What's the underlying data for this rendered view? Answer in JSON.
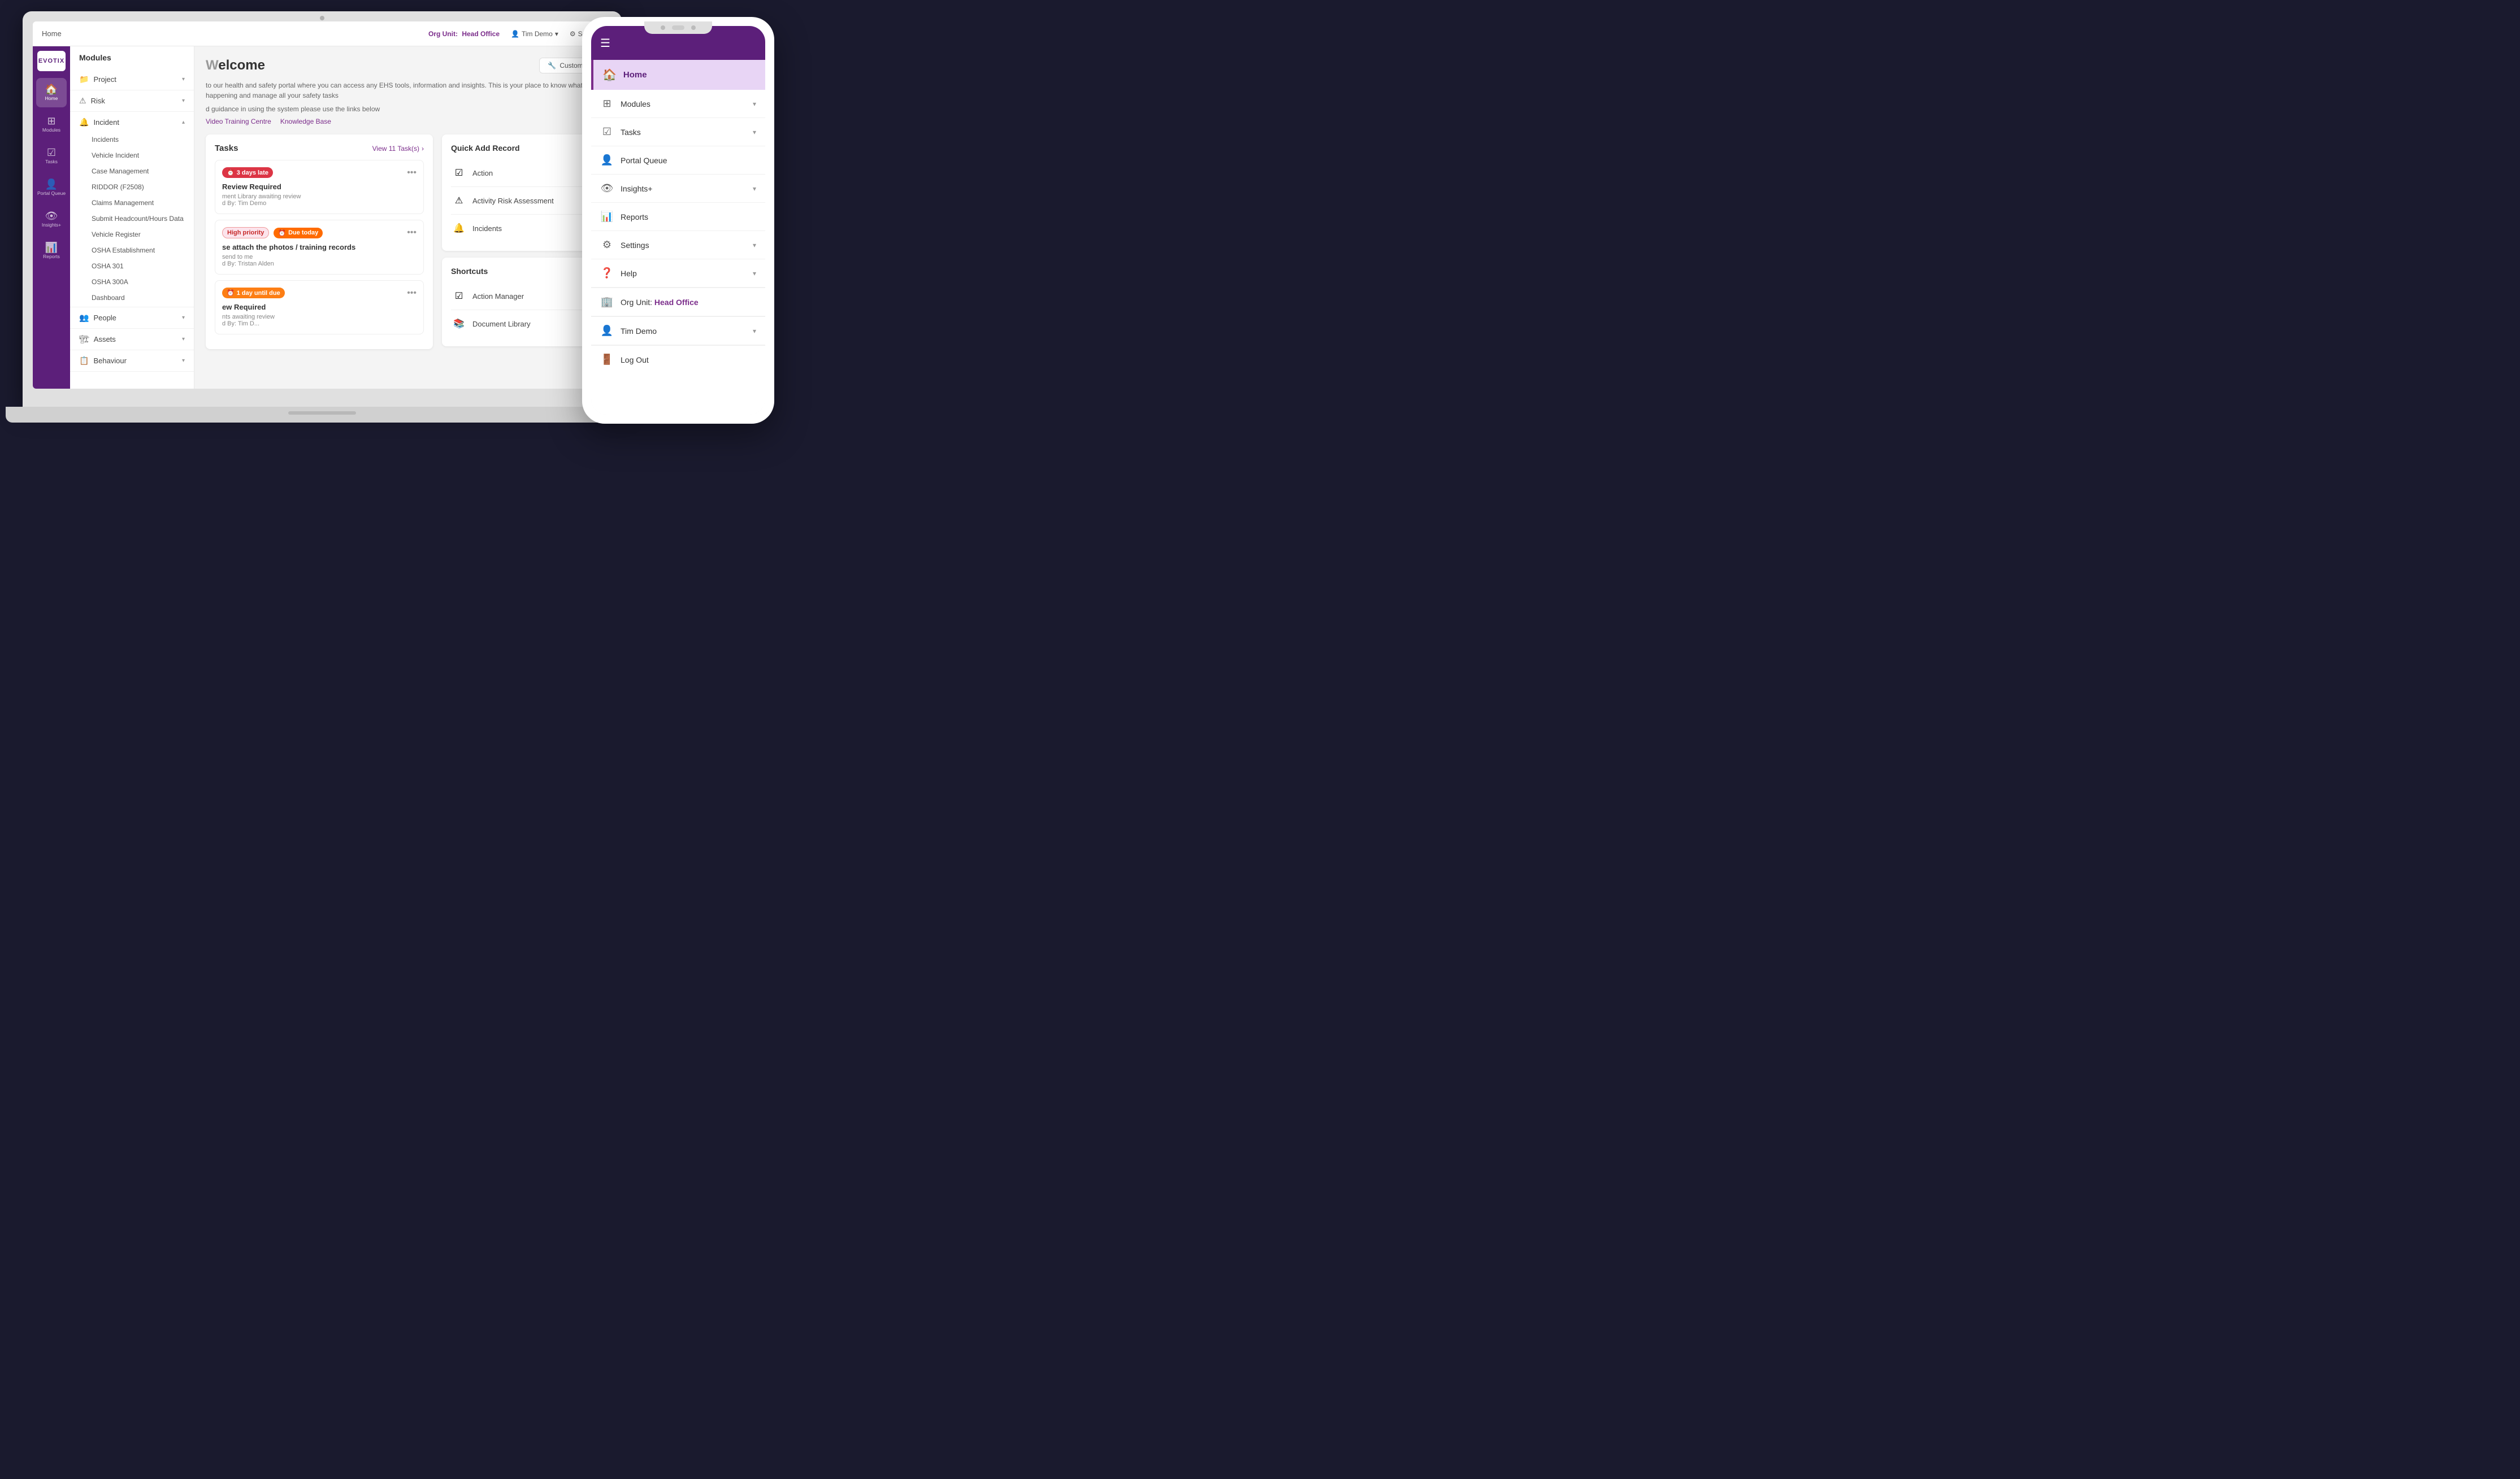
{
  "app": {
    "logo": "EVOTIX"
  },
  "topbar": {
    "breadcrumb": "Home",
    "org_unit_label": "Org Unit:",
    "org_unit_value": "Head Office",
    "user": "Tim Demo",
    "settings": "Settings"
  },
  "sidebar": {
    "items": [
      {
        "id": "home",
        "icon": "🏠",
        "label": "Home",
        "active": true
      },
      {
        "id": "modules",
        "icon": "⊞",
        "label": "Modules",
        "active": false
      },
      {
        "id": "tasks",
        "icon": "✓",
        "label": "Tasks",
        "active": false
      },
      {
        "id": "portal-queue",
        "icon": "👤",
        "label": "Portal Queue",
        "active": false
      },
      {
        "id": "insights",
        "icon": "👁",
        "label": "Insights+",
        "active": false
      },
      {
        "id": "reports",
        "icon": "📊",
        "label": "Reports",
        "active": false
      }
    ]
  },
  "modules_panel": {
    "title": "Modules",
    "groups": [
      {
        "id": "project",
        "icon": "📁",
        "label": "Project",
        "expanded": false,
        "items": []
      },
      {
        "id": "risk",
        "icon": "⚠",
        "label": "Risk",
        "expanded": false,
        "items": []
      },
      {
        "id": "incident",
        "icon": "🔔",
        "label": "Incident",
        "expanded": true,
        "items": [
          "Incidents",
          "Vehicle Incident",
          "Case Management",
          "RIDDOR (F2508)",
          "Claims Management",
          "Submit Headcount/Hours Data",
          "Vehicle Register",
          "OSHA Establishment",
          "OSHA 301",
          "OSHA 300A",
          "Dashboard"
        ]
      },
      {
        "id": "people",
        "icon": "👥",
        "label": "People",
        "expanded": false,
        "items": []
      },
      {
        "id": "assets",
        "icon": "🏗",
        "label": "Assets",
        "expanded": false,
        "items": []
      },
      {
        "id": "behaviour",
        "icon": "📋",
        "label": "Behaviour",
        "expanded": false,
        "items": []
      }
    ]
  },
  "welcome": {
    "title": "Welcome",
    "description": "to our health and safety portal where you can access any EHS tools, information and insights. This is your place to know what's happening and manage all your safety tasks",
    "guidance": "d guidance in using the system please use the links below",
    "links": [
      "Video Training Centre",
      "Knowledge Base"
    ],
    "customise_label": "Customise"
  },
  "tasks": {
    "title": "Tasks",
    "view_all": "View 11 Task(s)",
    "items": [
      {
        "badge_type": "red",
        "badge_label": "3 days late",
        "badge_icon": "⏰",
        "title": "Review Required",
        "subtitle": "ment Library awaiting review",
        "assigned": "d By: Tim Demo",
        "high_priority": false,
        "due_today": false,
        "one_day": false
      },
      {
        "badge_type": "high",
        "badge_label": "High priority",
        "due_label": "Due today",
        "title": "se attach the photos / training records",
        "subtitle": "send to me",
        "assigned": "d By: Tristan Alden",
        "high_priority": true,
        "due_today": true,
        "one_day": false
      },
      {
        "badge_type": "orange",
        "badge_label": "1 day until due",
        "badge_icon": "⏰",
        "title": "ew Required",
        "subtitle": "nts awaiting review",
        "assigned": "d By: Tim D...",
        "high_priority": false,
        "due_today": false,
        "one_day": true
      }
    ]
  },
  "quick_add": {
    "title": "Quick Add Record",
    "items": [
      {
        "icon": "✅",
        "label": "Action"
      },
      {
        "icon": "⚠",
        "label": "Activity Risk Assessment"
      },
      {
        "icon": "🔔",
        "label": "Incidents"
      }
    ]
  },
  "shortcuts": {
    "title": "Shortcuts",
    "items": [
      {
        "icon": "✅",
        "label": "Action Manager"
      },
      {
        "icon": "📚",
        "label": "Document Library"
      }
    ]
  },
  "phone": {
    "menu_items": [
      {
        "id": "home",
        "icon": "🏠",
        "label": "Home",
        "active": true,
        "has_arrow": false
      },
      {
        "id": "modules",
        "icon": "⊞",
        "label": "Modules",
        "active": false,
        "has_arrow": true
      },
      {
        "id": "tasks",
        "icon": "✓",
        "label": "Tasks",
        "active": false,
        "has_arrow": true
      },
      {
        "id": "portal-queue",
        "icon": "👤",
        "label": "Portal Queue",
        "active": false,
        "has_arrow": false
      },
      {
        "id": "insights",
        "icon": "👁",
        "label": "Insights+",
        "active": false,
        "has_arrow": true
      },
      {
        "id": "reports",
        "icon": "📊",
        "label": "Reports",
        "active": false,
        "has_arrow": false
      },
      {
        "id": "settings",
        "icon": "⚙",
        "label": "Settings",
        "active": false,
        "has_arrow": true
      },
      {
        "id": "help",
        "icon": "❓",
        "label": "Help",
        "active": false,
        "has_arrow": true
      }
    ],
    "org_unit_label": "Org Unit:",
    "org_unit_value": "Head Office",
    "user": "Tim Demo",
    "logout": "Log Out"
  }
}
